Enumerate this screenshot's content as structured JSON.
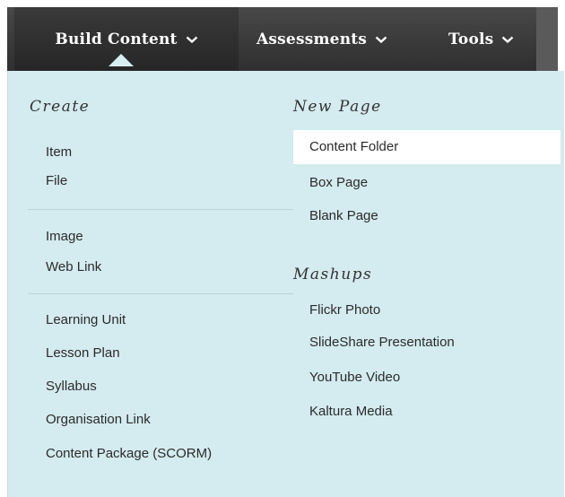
{
  "toolbar": {
    "tabs": [
      {
        "label": "Build Content",
        "icon": "chevron-down-icon",
        "active": true
      },
      {
        "label": "Assessments",
        "icon": "chevron-down-icon",
        "active": false
      },
      {
        "label": "Tools",
        "icon": "chevron-down-icon",
        "active": false
      }
    ]
  },
  "menu": {
    "create": {
      "heading": "Create",
      "group1": [
        "Item",
        "File"
      ],
      "group2": [
        "Image",
        "Web Link"
      ],
      "group3": [
        "Learning Unit",
        "Lesson Plan",
        "Syllabus",
        "Organisation Link",
        "Content Package (SCORM)"
      ]
    },
    "new_page": {
      "heading": "New Page",
      "items": [
        "Content Folder",
        "Box Page",
        "Blank Page"
      ],
      "highlighted": "Content Folder"
    },
    "mashups": {
      "heading": "Mashups",
      "items": [
        "Flickr Photo",
        "SlideShare Presentation",
        "YouTube Video",
        "Kaltura Media"
      ]
    }
  },
  "colors": {
    "toolbar": "#3b3b3b",
    "panel": "#d4ebef",
    "highlight": "#ffffff",
    "text": "#2b2b2b"
  }
}
